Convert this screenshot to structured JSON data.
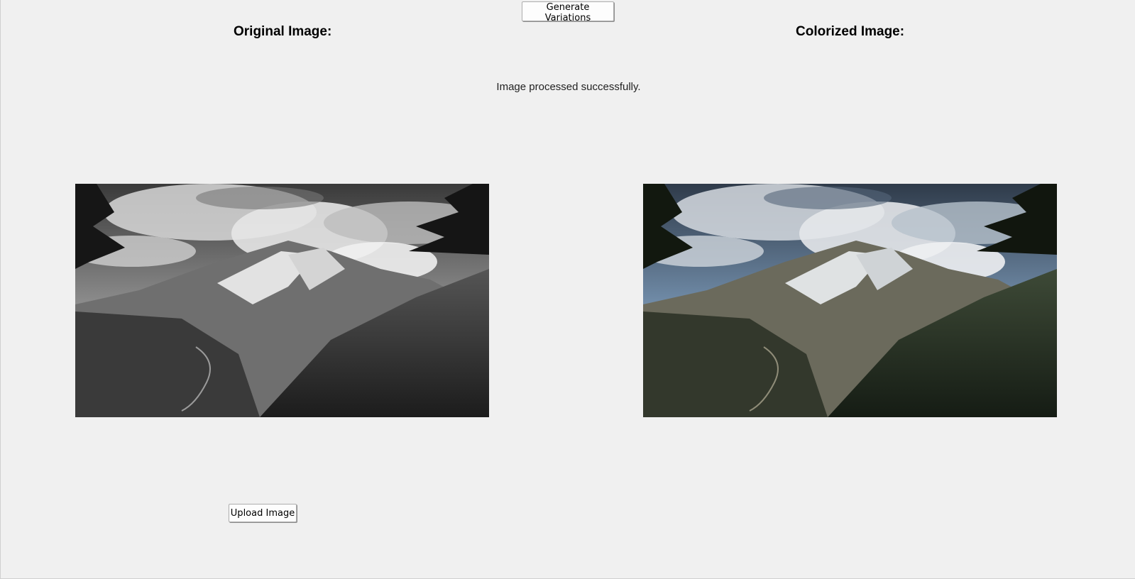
{
  "toolbar": {
    "generate_label": "Generate Variations"
  },
  "panels": {
    "original": {
      "title": "Original Image:"
    },
    "colorized": {
      "title": "Colorized Image:"
    }
  },
  "status": {
    "message": "Image processed successfully."
  },
  "actions": {
    "upload_label": "Upload Image"
  },
  "images": {
    "original": {
      "subject": "mountain-glacier-landscape",
      "mode": "grayscale"
    },
    "colorized": {
      "subject": "mountain-glacier-landscape",
      "mode": "color"
    }
  },
  "colors": {
    "window_bg": "#f0f0f0",
    "button_bg": "#fdfdfd",
    "button_border": "#adadad",
    "sky_blue": "#5f7a96",
    "forest_green": "#2a3526"
  }
}
